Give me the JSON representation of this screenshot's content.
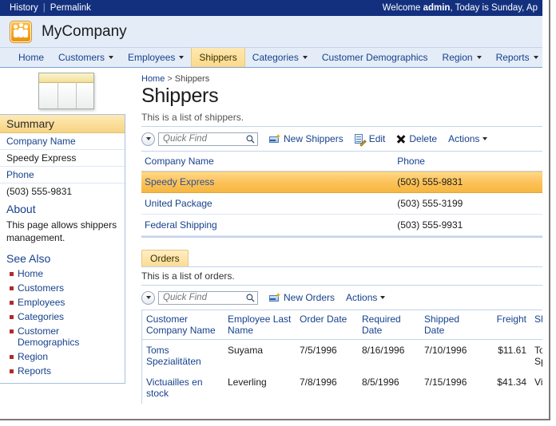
{
  "topbar": {
    "history": "History",
    "separator": "|",
    "permalink": "Permalink",
    "welcome_prefix": "Welcome ",
    "welcome_user": "admin",
    "welcome_suffix": ", Today is Sunday, Ap"
  },
  "brand": {
    "company": "MyCompany",
    "logo_icon": "people-group-icon"
  },
  "nav": {
    "items": [
      {
        "label": "Home",
        "has_caret": false,
        "active": false
      },
      {
        "label": "Customers",
        "has_caret": true,
        "active": false
      },
      {
        "label": "Employees",
        "has_caret": true,
        "active": false
      },
      {
        "label": "Shippers",
        "has_caret": false,
        "active": true
      },
      {
        "label": "Categories",
        "has_caret": true,
        "active": false
      },
      {
        "label": "Customer Demographics",
        "has_caret": false,
        "active": false
      },
      {
        "label": "Region",
        "has_caret": true,
        "active": false
      },
      {
        "label": "Reports",
        "has_caret": true,
        "active": false
      }
    ]
  },
  "sidebar": {
    "icon": "data-grid-icon",
    "summary_title": "Summary",
    "summary_rows": [
      {
        "label": "Company Name",
        "value": "Speedy Express"
      },
      {
        "label": "Phone",
        "value": "(503) 555-9831"
      }
    ],
    "about_title": "About",
    "about_text": "This page allows shippers management.",
    "see_also_title": "See Also",
    "see_also": [
      "Home",
      "Customers",
      "Employees",
      "Categories",
      "Customer Demographics",
      "Region",
      "Reports"
    ]
  },
  "main": {
    "breadcrumb": {
      "root": "Home",
      "sep": ">",
      "current": "Shippers"
    },
    "title": "Shippers",
    "subtitle": "This is a list of shippers."
  },
  "toolbar": {
    "expand_icon": "chevron-down-circle-icon",
    "quick_find_placeholder": "Quick Find",
    "quick_find_value": "",
    "search_icon": "magnifier-icon",
    "new_label": "New Shippers",
    "new_icon": "new-record-icon",
    "edit_label": "Edit",
    "edit_icon": "edit-pencil-icon",
    "delete_label": "Delete",
    "delete_icon": "delete-x-icon",
    "actions_label": "Actions",
    "actions_caret": "chevron-down-icon"
  },
  "shippers_grid": {
    "columns": [
      "Company Name",
      "Phone"
    ],
    "rows": [
      {
        "company": "Speedy Express",
        "phone": "(503) 555-9831",
        "selected": true
      },
      {
        "company": "United Package",
        "phone": "(503) 555-3199",
        "selected": false
      },
      {
        "company": "Federal Shipping",
        "phone": "(503) 555-9931",
        "selected": false
      }
    ]
  },
  "orders_section": {
    "tab_label": "Orders",
    "subtitle": "This is a list of orders.",
    "toolbar": {
      "expand_icon": "chevron-down-circle-icon",
      "quick_find_placeholder": "Quick Find",
      "quick_find_value": "",
      "search_icon": "magnifier-icon",
      "new_label": "New Orders",
      "new_icon": "new-record-icon",
      "actions_label": "Actions",
      "actions_caret": "chevron-down-icon"
    },
    "columns": [
      "Customer Company Name",
      "Employee Last Name",
      "Order Date",
      "Required Date",
      "Shipped Date",
      "Freight",
      "Ship Nam"
    ],
    "rows": [
      {
        "customer": "Toms Spezialitäten",
        "employee": "Suyama",
        "order_date": "7/5/1996",
        "required_date": "8/16/1996",
        "shipped_date": "7/10/1996",
        "freight": "$11.61",
        "ship_name": "Toms Spezialitä"
      },
      {
        "customer": "Victuailles en stock",
        "employee": "Leverling",
        "order_date": "7/8/1996",
        "required_date": "8/5/1996",
        "shipped_date": "7/15/1996",
        "freight": "$41.34",
        "ship_name": "Victuaille stock"
      }
    ]
  },
  "colors": {
    "topbar_blue": "#13307f",
    "band_blue": "#e4ecf7",
    "link_blue": "#16418c",
    "accent_amber": "#f5b63f",
    "tab_amber": "#fbdc95",
    "bullet_red": "#b02b2b"
  }
}
